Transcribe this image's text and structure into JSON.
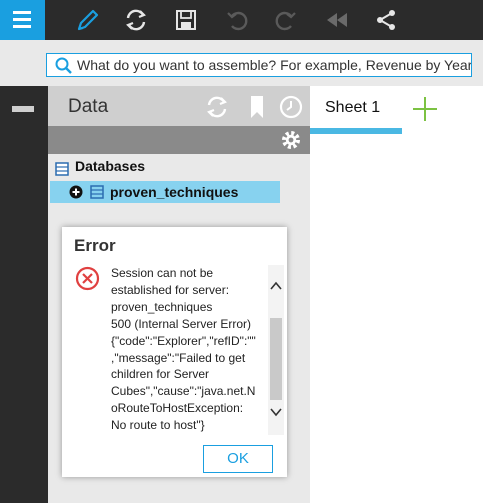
{
  "toolbar": {
    "icons": [
      "menu-icon",
      "pencil-icon",
      "refresh-icon",
      "save-icon",
      "undo-icon",
      "redo-icon",
      "rewind-icon",
      "share-icon"
    ]
  },
  "search": {
    "text": "What do you want to assemble? For example, Revenue by Year"
  },
  "data_panel": {
    "title": "Data",
    "tree": {
      "root_label": "Databases",
      "selected_label": "proven_techniques"
    }
  },
  "sheets": {
    "tabs": [
      {
        "label": "Sheet 1"
      }
    ]
  },
  "dialog": {
    "title": "Error",
    "message": "Session can not be\nestablished for server:\nproven_techniques\n500 (Internal Server Error)\n{\"code\":\"Explorer\",\"refID\":\"\"\n,\"message\":\"Failed to get\nchildren for Server\nCubes\",\"cause\":\"java.net.N\noRouteToHostException:\nNo route to host\"}",
    "ok_label": "OK"
  },
  "colors": {
    "accent": "#1a9fe0",
    "toolbar_bg": "#2b2b2b",
    "selection_bg": "#87d2ef",
    "add_sheet_green": "#7cc242",
    "error_red": "#e04040"
  }
}
